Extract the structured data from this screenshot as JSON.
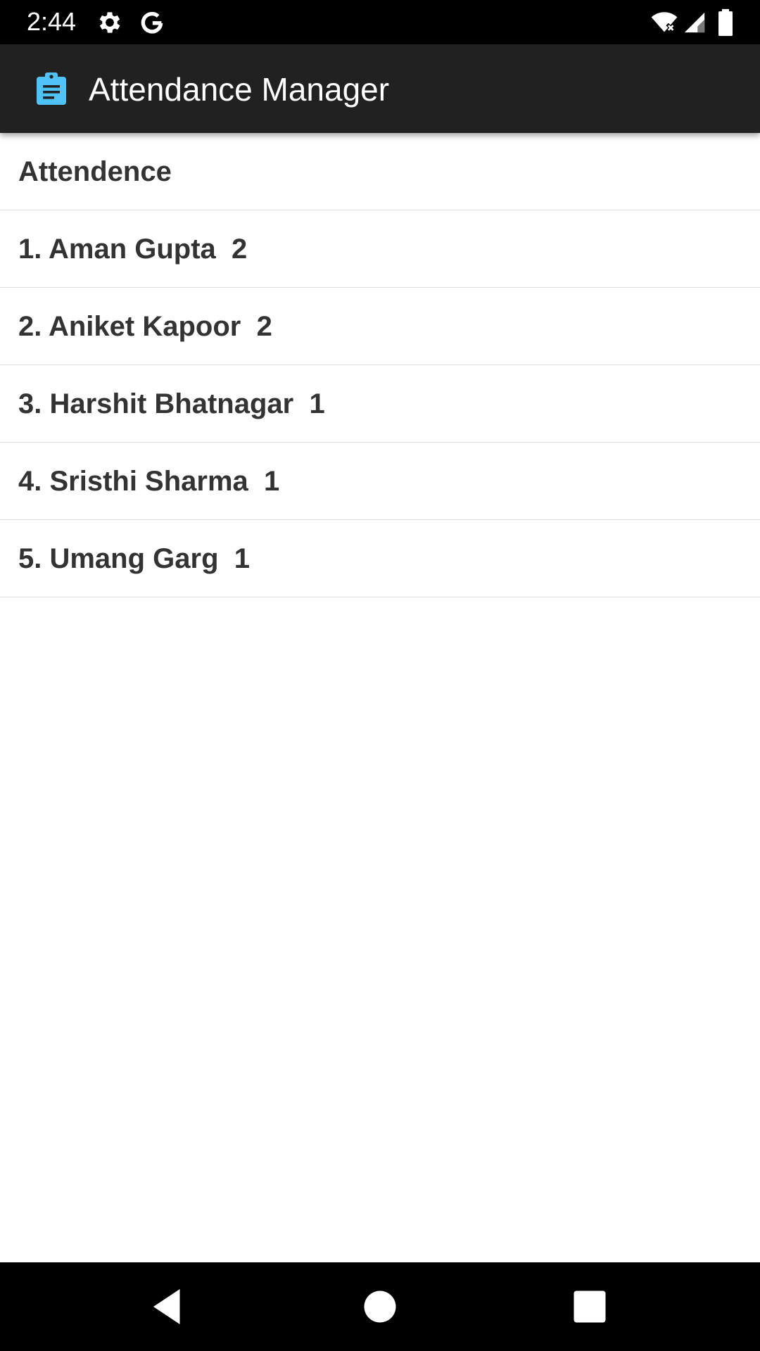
{
  "status_bar": {
    "time": "2:44",
    "icons": [
      "gear-icon",
      "google-g-icon",
      "wifi-icon",
      "signal-icon",
      "battery-icon"
    ]
  },
  "app_bar": {
    "icon": "clipboard-icon",
    "title": "Attendance Manager",
    "accent_color": "#4fc3f7",
    "background": "#212121"
  },
  "list": {
    "header": "Attendence",
    "items": [
      {
        "text": "1. Aman Gupta  2"
      },
      {
        "text": "2. Aniket Kapoor  2"
      },
      {
        "text": "3. Harshit Bhatnagar  1"
      },
      {
        "text": "4. Sristhi Sharma  1"
      },
      {
        "text": "5. Umang Garg  1"
      }
    ]
  },
  "nav_bar": {
    "buttons": [
      "back-icon",
      "home-icon",
      "recents-icon"
    ]
  }
}
